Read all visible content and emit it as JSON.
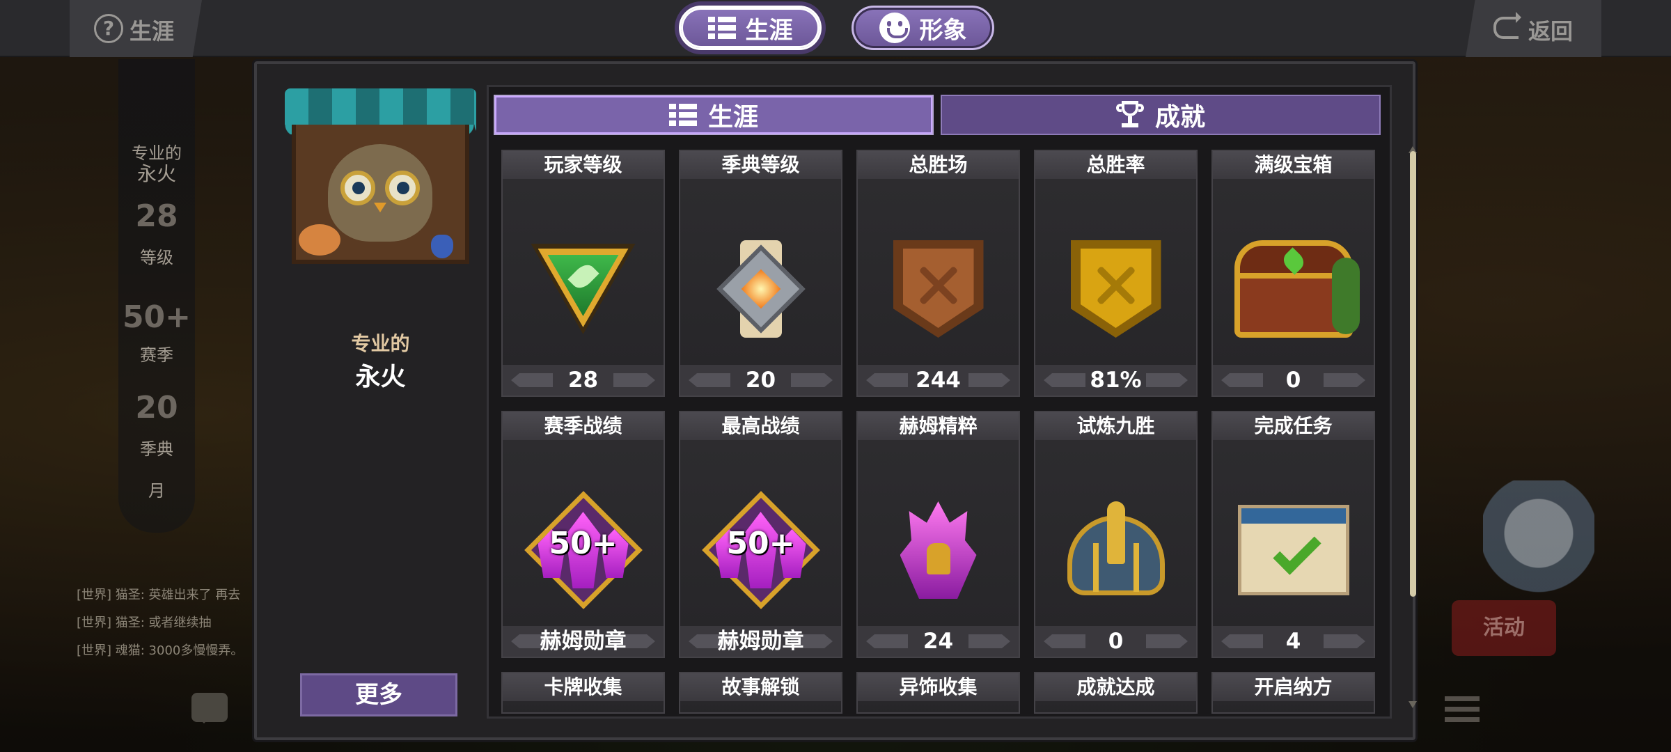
{
  "topbar": {
    "help_icon": "help-circle-icon",
    "left_title": "生涯",
    "tabs": [
      {
        "label": "生涯",
        "icon": "list-icon",
        "active": true
      },
      {
        "label": "形象",
        "icon": "smile-icon",
        "active": false
      }
    ],
    "back_label": "返回",
    "back_icon": "return-arrow-icon"
  },
  "background": {
    "side_labels": [
      "专业的",
      "永火",
      "28",
      "等级",
      "50+",
      "赛季",
      "20",
      "季典",
      "月"
    ],
    "chat_lines": [
      "[世界] 猫圣: 英雄出来了 再去",
      "[世界] 猫圣: 或者继续抽",
      "[世界] 魂猫: 3000多慢慢弄。"
    ],
    "activity_label": "活动"
  },
  "profile": {
    "subtitle": "专业的",
    "name": "永火",
    "more_label": "更多"
  },
  "subtabs": [
    {
      "label": "生涯",
      "icon": "list-icon",
      "active": true
    },
    {
      "label": "成就",
      "icon": "trophy-icon",
      "active": false
    }
  ],
  "stats": [
    {
      "label": "玩家等级",
      "value": "28",
      "icon": "green-triangle-emblem-icon"
    },
    {
      "label": "季典等级",
      "value": "20",
      "icon": "scroll-diamond-emblem-icon"
    },
    {
      "label": "总胜场",
      "value": "244",
      "icon": "bronze-shield-swords-icon"
    },
    {
      "label": "总胜率",
      "value": "81%",
      "icon": "gold-shield-swords-icon"
    },
    {
      "label": "满级宝箱",
      "value": "0",
      "icon": "treasure-chest-icon"
    },
    {
      "label": "赛季战绩",
      "value": "赫姆勋章",
      "icon": "crystal-medal-icon",
      "badge": "50+"
    },
    {
      "label": "最高战绩",
      "value": "赫姆勋章",
      "icon": "crystal-medal-icon",
      "badge": "50+"
    },
    {
      "label": "赫姆精粹",
      "value": "24",
      "icon": "purple-crystal-essence-icon"
    },
    {
      "label": "试炼九胜",
      "value": "0",
      "icon": "golden-helmet-icon"
    },
    {
      "label": "完成任务",
      "value": "4",
      "icon": "checked-scroll-icon"
    },
    {
      "label": "卡牌收集"
    },
    {
      "label": "故事解锁"
    },
    {
      "label": "异饰收集"
    },
    {
      "label": "成就达成"
    },
    {
      "label": "开启纳方"
    }
  ],
  "colors": {
    "tab_active": "#7a64aa",
    "tab_inactive": "#5f4b87",
    "panel_bg": "#232224",
    "title_gold": "#e2c9a3"
  }
}
